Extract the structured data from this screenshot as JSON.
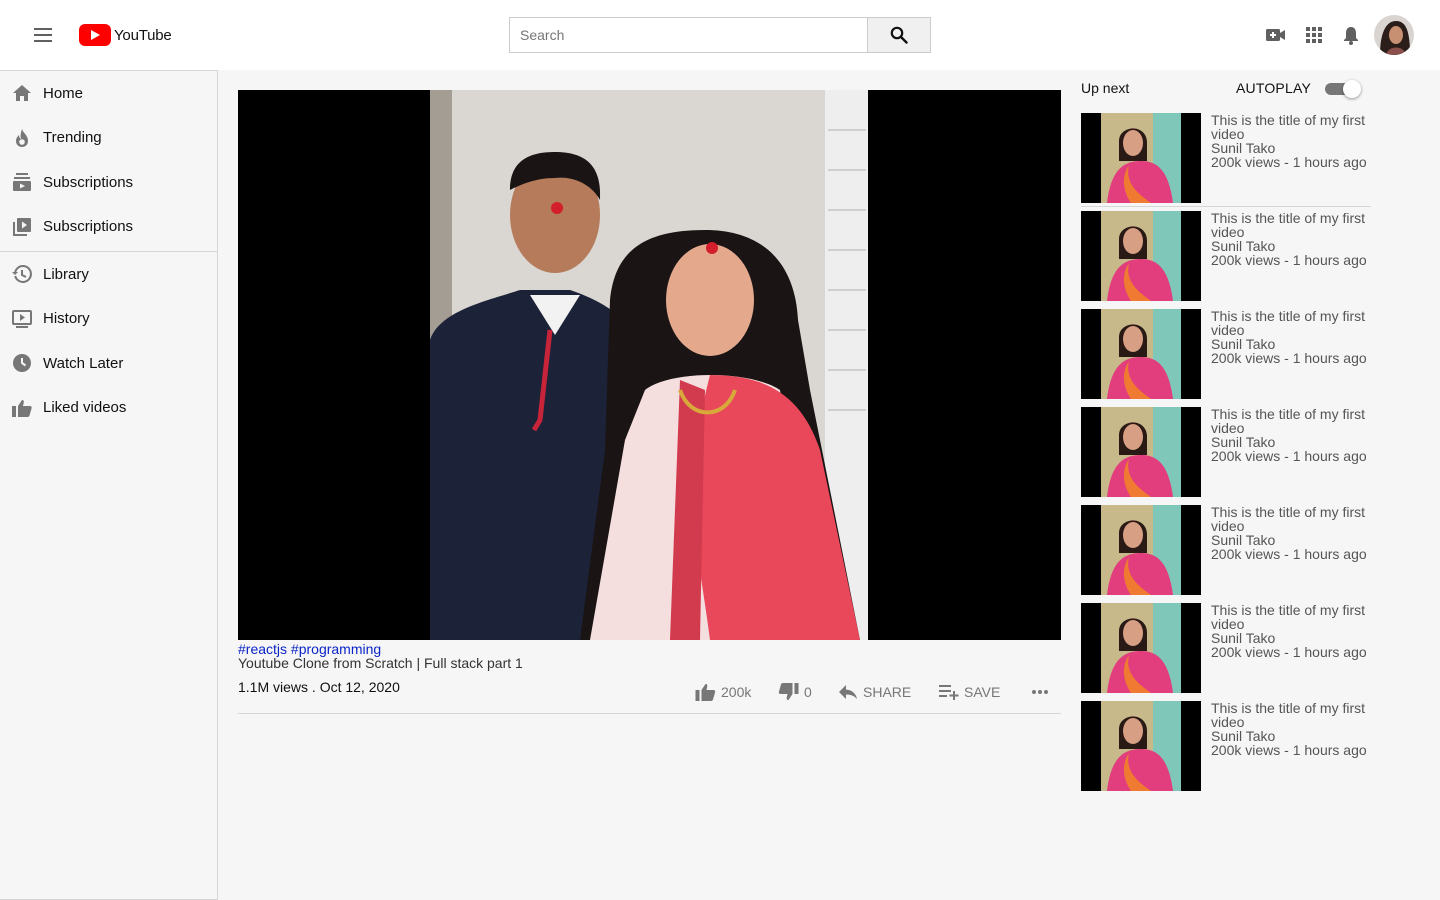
{
  "header": {
    "menu_icon": "hamburger-menu-icon",
    "logo_text": "YouTube",
    "brand_color": "#ff0000",
    "search_placeholder": "Search",
    "icons": [
      "video-camera-icon",
      "apps-grid-icon",
      "bell-icon"
    ]
  },
  "sidebar": {
    "items": [
      {
        "label": "Home",
        "icon": "home-icon"
      },
      {
        "label": "Trending",
        "icon": "fire-icon"
      },
      {
        "label": "Subscriptions",
        "icon": "subscriptions-icon"
      },
      {
        "label": "Subscriptions",
        "icon": "play-library-icon"
      },
      {
        "label": "Library",
        "icon": "history-clock-icon"
      },
      {
        "label": "History",
        "icon": "play-box-icon"
      },
      {
        "label": "Watch Later",
        "icon": "clock-icon"
      },
      {
        "label": "Liked videos",
        "icon": "thumbs-up-icon"
      }
    ]
  },
  "video": {
    "tags": [
      "#reactjs",
      "#programming"
    ],
    "title": "Youtube Clone from Scratch | Full stack part 1",
    "meta": "1.1M views . Oct 12, 2020",
    "likes": "200k",
    "dislikes": "0",
    "share_label": "SHARE",
    "save_label": "SAVE",
    "more_icon": "more-horizontal-icon"
  },
  "up_next": {
    "label": "Up next",
    "autoplay_label": "AUTOPLAY",
    "autoplay_on": true,
    "items": [
      {
        "title": "This is the title of my first video",
        "channel": "Sunil Tako",
        "stats": "200k views - 1 hours ago"
      },
      {
        "title": "This is the title of my first video",
        "channel": "Sunil Tako",
        "stats": "200k views - 1 hours ago"
      },
      {
        "title": "This is the title of my first video",
        "channel": "Sunil Tako",
        "stats": "200k views - 1 hours ago"
      },
      {
        "title": "This is the title of my first video",
        "channel": "Sunil Tako",
        "stats": "200k views - 1 hours ago"
      },
      {
        "title": "This is the title of my first video",
        "channel": "Sunil Tako",
        "stats": "200k views - 1 hours ago"
      },
      {
        "title": "This is the title of my first video",
        "channel": "Sunil Tako",
        "stats": "200k views - 1 hours ago"
      },
      {
        "title": "This is the title of my first video",
        "channel": "Sunil Tako",
        "stats": "200k views - 1 hours ago"
      }
    ]
  }
}
